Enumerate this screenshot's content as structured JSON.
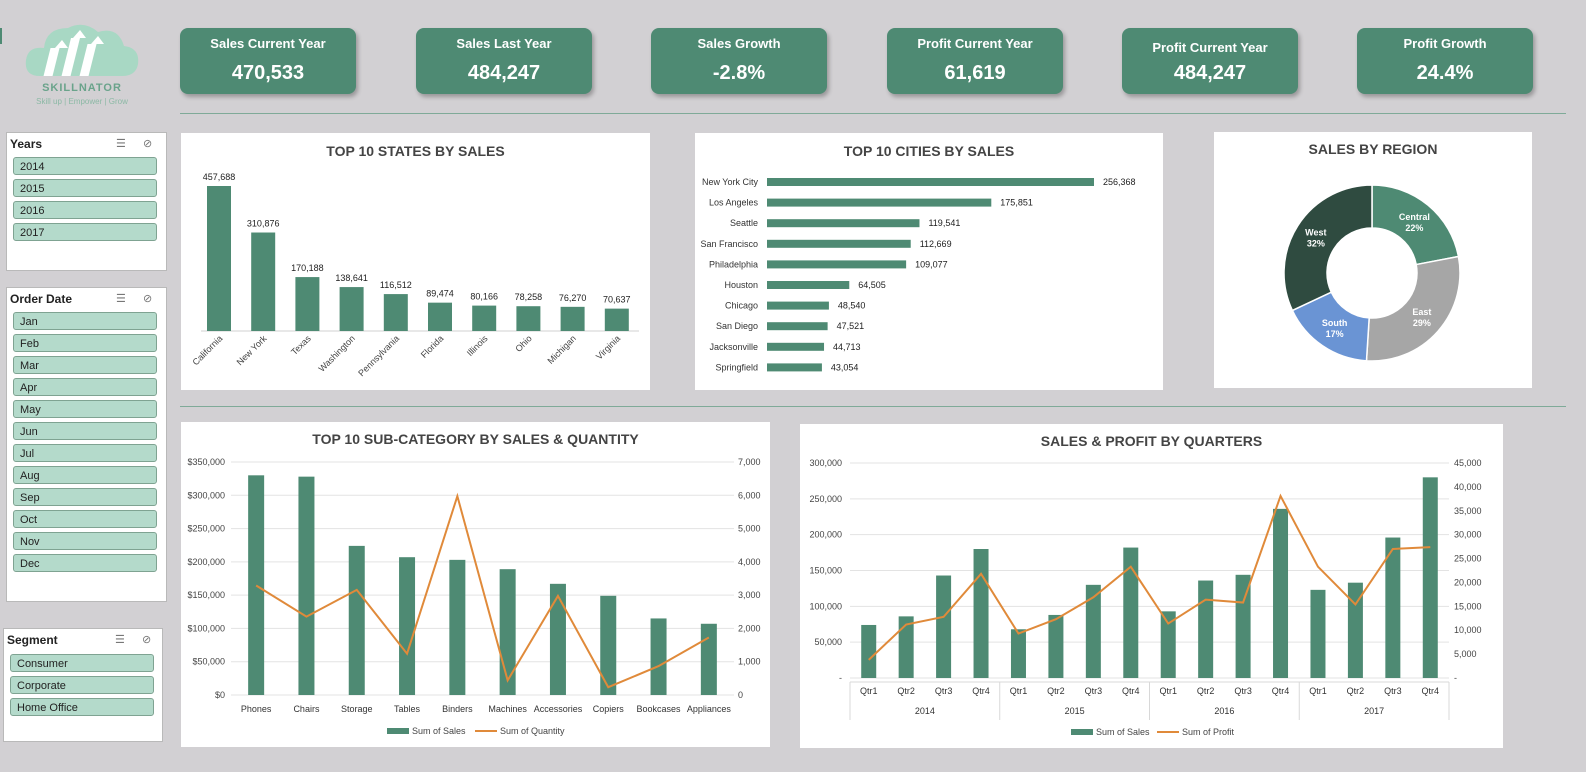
{
  "logo": {
    "name": "SKILLNATOR",
    "tagline": "Skill up | Empower | Grow"
  },
  "kpis": [
    {
      "label": "Sales Current Year",
      "value": "470,533"
    },
    {
      "label": "Sales Last Year",
      "value": "484,247"
    },
    {
      "label": "Sales  Growth",
      "value": "-2.8%"
    },
    {
      "label": "Profit Current Year",
      "value": "61,619"
    },
    {
      "label": "Profit Current Year",
      "value": "484,247"
    },
    {
      "label": "Profit Growth",
      "value": "24.4%"
    }
  ],
  "slicers": {
    "years": {
      "title": "Years",
      "items": [
        "2014",
        "2015",
        "2016",
        "2017"
      ]
    },
    "order_date": {
      "title": "Order Date",
      "items": [
        "Jan",
        "Feb",
        "Mar",
        "Apr",
        "May",
        "Jun",
        "Jul",
        "Aug",
        "Sep",
        "Oct",
        "Nov",
        "Dec"
      ]
    },
    "segment": {
      "title": "Segment",
      "items": [
        "Consumer",
        "Corporate",
        "Home Office"
      ]
    }
  },
  "colors": {
    "green": "#4e8a73",
    "orange": "#e08a3a",
    "dark": "#2f4b40",
    "blue": "#6a94d4",
    "gray": "#a6a6a6"
  },
  "chart_data": [
    {
      "type": "bar",
      "title": "TOP 10 STATES BY SALES",
      "categories": [
        "California",
        "New York",
        "Texas",
        "Washington",
        "Pennsylvania",
        "Florida",
        "Illinois",
        "Ohio",
        "Michigan",
        "Virginia"
      ],
      "values": [
        457688,
        310876,
        170188,
        138641,
        116512,
        89474,
        80166,
        78258,
        76270,
        70637
      ],
      "labels": [
        "457,688",
        "310,876",
        "170,188",
        "138,641",
        "116,512",
        "89,474",
        "80,166",
        "78,258",
        "76,270",
        "70,637"
      ]
    },
    {
      "type": "bar",
      "orientation": "horizontal",
      "title": "TOP 10 CITIES BY SALES",
      "categories": [
        "New York City",
        "Los Angeles",
        "Seattle",
        "San Francisco",
        "Philadelphia",
        "Houston",
        "Chicago",
        "San Diego",
        "Jacksonville",
        "Springfield"
      ],
      "values": [
        256368,
        175851,
        119541,
        112669,
        109077,
        64505,
        48540,
        47521,
        44713,
        43054
      ],
      "labels": [
        "256,368",
        "175,851",
        "119,541",
        "112,669",
        "109,077",
        "64,505",
        "48,540",
        "47,521",
        "44,713",
        "43,054"
      ]
    },
    {
      "type": "pie",
      "title": "SALES BY REGION",
      "slices": [
        {
          "name": "Central",
          "value": 22,
          "label": "22%"
        },
        {
          "name": "East",
          "value": 29,
          "label": "29%"
        },
        {
          "name": "South",
          "value": 17,
          "label": "17%"
        },
        {
          "name": "West",
          "value": 32,
          "label": "32%"
        }
      ]
    },
    {
      "type": "bar",
      "title": "TOP 10 SUB-CATEGORY BY SALES & QUANTITY",
      "categories": [
        "Phones",
        "Chairs",
        "Storage",
        "Tables",
        "Binders",
        "Machines",
        "Accessories",
        "Copiers",
        "Bookcases",
        "Appliances"
      ],
      "series": [
        {
          "name": "Sum of Sales",
          "type": "bar",
          "axis": "left",
          "values": [
            330000,
            328000,
            224000,
            207000,
            203000,
            189000,
            167000,
            149000,
            115000,
            107000
          ]
        },
        {
          "name": "Sum of Quantity",
          "type": "line",
          "axis": "right",
          "values": [
            3289,
            2356,
            3158,
            1241,
            5974,
            440,
            2976,
            234,
            868,
            1729
          ]
        }
      ],
      "ylim": [
        0,
        350000
      ],
      "y2lim": [
        0,
        7000
      ],
      "yticks": [
        "$0",
        "$50,000",
        "$100,000",
        "$150,000",
        "$200,000",
        "$250,000",
        "$300,000",
        "$350,000"
      ],
      "y2ticks": [
        "0",
        "1,000",
        "2,000",
        "3,000",
        "4,000",
        "5,000",
        "6,000",
        "7,000"
      ],
      "legend": "bottom"
    },
    {
      "type": "bar",
      "title": "SALES & PROFIT BY QUARTERS",
      "categories": [
        "Qtr1",
        "Qtr2",
        "Qtr3",
        "Qtr4",
        "Qtr1",
        "Qtr2",
        "Qtr3",
        "Qtr4",
        "Qtr1",
        "Qtr2",
        "Qtr3",
        "Qtr4",
        "Qtr1",
        "Qtr2",
        "Qtr3",
        "Qtr4"
      ],
      "groups": [
        "2014",
        "2015",
        "2016",
        "2017"
      ],
      "series": [
        {
          "name": "Sum of Sales",
          "type": "bar",
          "axis": "left",
          "values": [
            74000,
            86000,
            143000,
            180000,
            68000,
            88000,
            130000,
            182000,
            93000,
            136000,
            144000,
            236000,
            123000,
            133000,
            196000,
            280000
          ]
        },
        {
          "name": "Sum of Profit",
          "type": "line",
          "axis": "right",
          "values": [
            3800,
            11200,
            12800,
            21800,
            9300,
            12300,
            16900,
            23300,
            11400,
            16400,
            15800,
            38100,
            23300,
            15400,
            27000,
            27400
          ]
        }
      ],
      "ylim": [
        0,
        300000
      ],
      "y2lim": [
        0,
        45000
      ],
      "yticks": [
        "-",
        "50,000",
        "100,000",
        "150,000",
        "200,000",
        "250,000",
        "300,000"
      ],
      "y2ticks": [
        "-",
        "5,000",
        "10,000",
        "15,000",
        "20,000",
        "25,000",
        "30,000",
        "35,000",
        "40,000",
        "45,000"
      ],
      "legend": "bottom"
    }
  ]
}
